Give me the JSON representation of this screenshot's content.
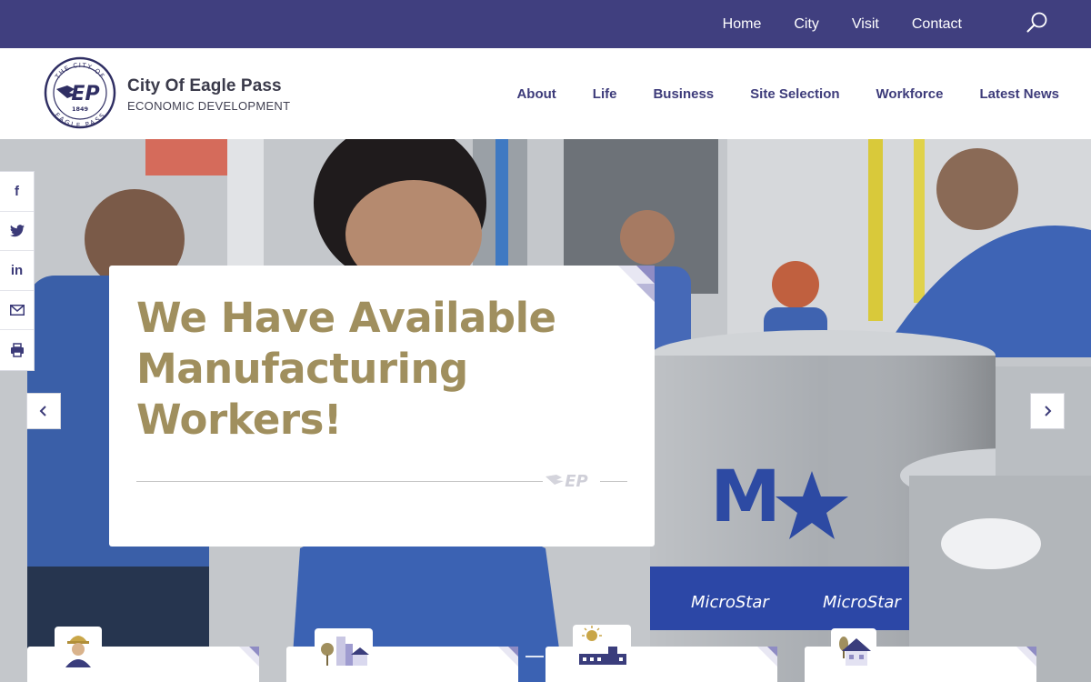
{
  "topbar": {
    "links": [
      "Home",
      "City",
      "Visit",
      "Contact"
    ],
    "search_icon": "search-icon"
  },
  "brand": {
    "name": "City Of Eagle Pass",
    "subtitle": "ECONOMIC DEVELOPMENT",
    "seal_text_top": "THE CITY OF",
    "seal_text_bottom": "EAGLE PASS",
    "seal_monogram": "EP",
    "seal_year": "1849"
  },
  "mainnav": {
    "items": [
      "About",
      "Life",
      "Business",
      "Site Selection",
      "Workforce",
      "Latest News"
    ]
  },
  "social": {
    "items": [
      {
        "icon": "facebook-icon",
        "glyph": "f"
      },
      {
        "icon": "twitter-icon",
        "glyph": "t"
      },
      {
        "icon": "linkedin-icon",
        "glyph": "in"
      },
      {
        "icon": "email-icon",
        "glyph": "✉"
      },
      {
        "icon": "print-icon",
        "glyph": "⎙"
      }
    ]
  },
  "hero": {
    "headline": "We Have Available Manufacturing Workers!",
    "keg_label_letter": "M",
    "keg_band_text": "MicroStar",
    "prev_icon": "chevron-left-icon",
    "next_icon": "chevron-right-icon"
  },
  "feature_cards": [
    {
      "icon": "worker-icon"
    },
    {
      "icon": "city-buildings-icon"
    },
    {
      "icon": "sun-factory-icon"
    },
    {
      "icon": "house-icon"
    }
  ],
  "colors": {
    "brand_purple": "#403f7f",
    "nav_text": "#3d3b7a",
    "headline_gold": "#a08f5e",
    "corner_lavender": "#b9b7d9"
  }
}
